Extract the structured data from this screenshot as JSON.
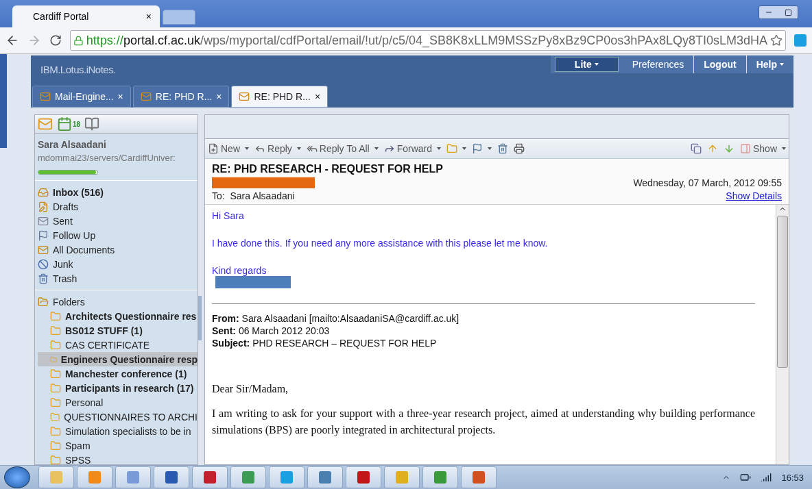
{
  "browser": {
    "tab": {
      "title": "Cardiff Portal",
      "close": "×"
    },
    "url": {
      "scheme": "https://",
      "host": "portal.cf.ac.uk",
      "path": "/wps/myportal/cdfPortal/email/!ut/p/c5/04_SB8K8xLLM9MSSzPy8xBz9CP0os3hPAx8LQy8TI0sLM3dHA"
    }
  },
  "app": {
    "logo": "IBM.Lotus.iNotes.",
    "header_links": [
      {
        "label": "Lite",
        "caret": true,
        "boxed": true
      },
      {
        "label": "Preferences",
        "caret": false,
        "boxed": false
      },
      {
        "label": "Logout",
        "caret": false,
        "boxed": false
      },
      {
        "label": "Help",
        "caret": true,
        "boxed": false
      }
    ],
    "tabs": [
      {
        "label": "Mail-Engine...",
        "close": "×",
        "selected": false
      },
      {
        "label": "RE: PHD R...",
        "close": "×",
        "selected": false
      },
      {
        "label": "RE: PHD R...",
        "close": "×",
        "selected": true
      }
    ]
  },
  "sidebar": {
    "calendar_day": "18",
    "user_name": "Sara Alsaadani",
    "server": "mdommai23/servers/CardiffUniver:",
    "quota": {
      "level": 0.98
    },
    "views": [
      {
        "label": "Inbox (516)",
        "unread": true
      },
      {
        "label": "Drafts",
        "unread": false
      },
      {
        "label": "Sent",
        "unread": false
      },
      {
        "label": "Follow Up",
        "unread": false
      },
      {
        "label": "All Documents",
        "unread": false
      },
      {
        "label": "Junk",
        "unread": false
      },
      {
        "label": "Trash",
        "unread": false
      }
    ],
    "folders_label": "Folders",
    "folders": [
      {
        "label": "Architects Questionnaire res",
        "unread": true,
        "selected": false
      },
      {
        "label": "BS012 STUFF (1)",
        "unread": true,
        "selected": false
      },
      {
        "label": "CAS CERTIFICATE",
        "unread": false,
        "selected": false
      },
      {
        "label": "Engineers Questionnaire resp",
        "unread": true,
        "selected": true
      },
      {
        "label": "Manchester conference (1)",
        "unread": true,
        "selected": false
      },
      {
        "label": "Participants in research (17)",
        "unread": true,
        "selected": false
      },
      {
        "label": "Personal",
        "unread": false,
        "selected": false
      },
      {
        "label": "QUESTIONNAIRES TO ARCHI",
        "unread": false,
        "selected": false
      },
      {
        "label": "Simulation specialists to be in",
        "unread": false,
        "selected": false
      },
      {
        "label": "Spam",
        "unread": false,
        "selected": false
      },
      {
        "label": "SPSS",
        "unread": false,
        "selected": false
      }
    ]
  },
  "toolbar": {
    "left": [
      {
        "kind": "labeled",
        "label": "New",
        "caret": true
      },
      {
        "kind": "labeled",
        "label": "Reply",
        "caret": true
      },
      {
        "kind": "labeled",
        "label": "Reply To All",
        "caret": true
      },
      {
        "kind": "labeled",
        "label": "Forward",
        "caret": true
      },
      {
        "kind": "icon",
        "caret": true
      },
      {
        "kind": "icon",
        "caret": true
      },
      {
        "kind": "icon",
        "caret": false
      },
      {
        "kind": "icon",
        "caret": false
      }
    ],
    "right": [
      {
        "kind": "icon",
        "caret": false
      },
      {
        "kind": "icon",
        "caret": false
      },
      {
        "kind": "icon",
        "caret": false
      },
      {
        "kind": "labeled",
        "label": "Show",
        "caret": true
      }
    ]
  },
  "message": {
    "subject": "RE: PHD RESEARCH - REQUEST FOR HELP",
    "date": "Wednesday, 07 March, 2012 09:55",
    "to_label": "To:",
    "to": "Sara Alsaadani",
    "show_details": "Show Details",
    "reply_lines": [
      "Hi Sara",
      "I have done this. If you need any more assistance with this please let me know.",
      "Kind regards"
    ],
    "quoted_header": [
      {
        "label": "From:",
        "value": "Sara Alsaadani [mailto:AlsaadaniSA@cardiff.ac.uk]"
      },
      {
        "label": "Sent:",
        "value": "06 March 2012 20:03"
      },
      {
        "label": "Subject:",
        "value": "PHD RESEARCH – REQUEST FOR HELP"
      }
    ],
    "letter": [
      "Dear Sir/Madam,",
      "I am writing to ask for your support with a three-year research project, aimed at understanding why building performance simulations (BPS) are poorly integrated in architectural projects."
    ]
  },
  "taskbar": {
    "clock": "16:53"
  }
}
